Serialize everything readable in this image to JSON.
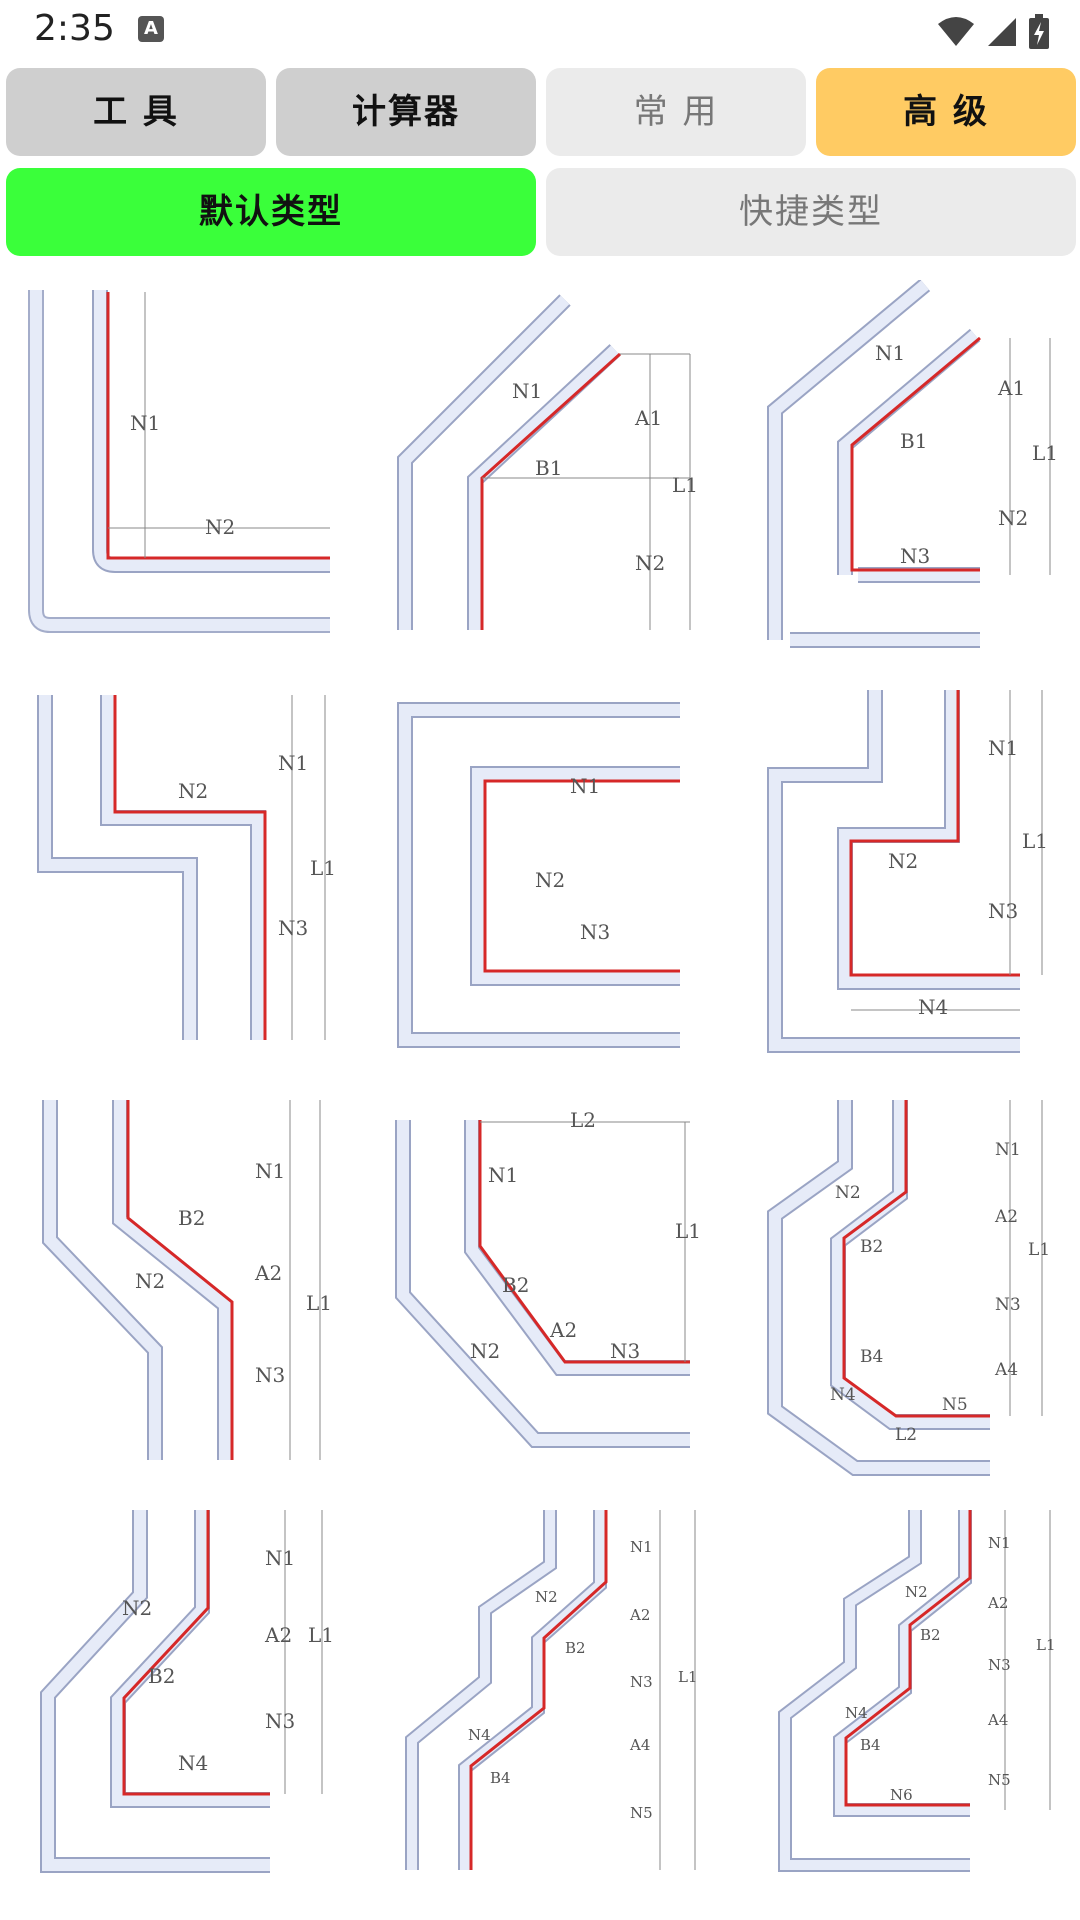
{
  "status_bar": {
    "time": "2:35",
    "input_badge": "A"
  },
  "tabs_top": [
    {
      "label": "工 具"
    },
    {
      "label": "计算器"
    },
    {
      "label": "常 用"
    },
    {
      "label": "高 级"
    }
  ],
  "tabs_sub": [
    {
      "label": "默认类型"
    },
    {
      "label": "快捷类型"
    }
  ],
  "colors": {
    "green": "#3aff3a",
    "orange": "#ffcb63",
    "grey": "#cfcfcf",
    "light": "#ebebeb",
    "pipe": "#e6ebf8",
    "line": "#e23c3c"
  },
  "diagrams": [
    {
      "labels": [
        "N1",
        "N2"
      ]
    },
    {
      "labels": [
        "N1",
        "A1",
        "B1",
        "L1",
        "N2"
      ]
    },
    {
      "labels": [
        "N1",
        "A1",
        "B1",
        "L1",
        "N2",
        "N3"
      ]
    },
    {
      "labels": [
        "N1",
        "N2",
        "L1",
        "N3"
      ]
    },
    {
      "labels": [
        "N1",
        "N2",
        "N3"
      ]
    },
    {
      "labels": [
        "N1",
        "L1",
        "N2",
        "N3",
        "N4"
      ]
    },
    {
      "labels": [
        "N1",
        "B2",
        "N2",
        "A2",
        "L1",
        "N3"
      ]
    },
    {
      "labels": [
        "L2",
        "N1",
        "L1",
        "B2",
        "A2",
        "N2",
        "N3"
      ]
    },
    {
      "labels": [
        "N1",
        "N2",
        "A2",
        "B2",
        "L1",
        "N3",
        "B4",
        "A4",
        "N5",
        "N4",
        "L2"
      ]
    },
    {
      "labels": [
        "N1",
        "N2",
        "A2",
        "L1",
        "B2",
        "N3",
        "N4"
      ]
    },
    {
      "labels": [
        "N1",
        "N2",
        "A2",
        "B2",
        "L1",
        "N3",
        "N4",
        "A4",
        "B4",
        "N5"
      ]
    },
    {
      "labels": [
        "N1",
        "N2",
        "A2",
        "B2",
        "L1",
        "N3",
        "N4",
        "A4",
        "B4",
        "N5",
        "N6"
      ]
    }
  ]
}
